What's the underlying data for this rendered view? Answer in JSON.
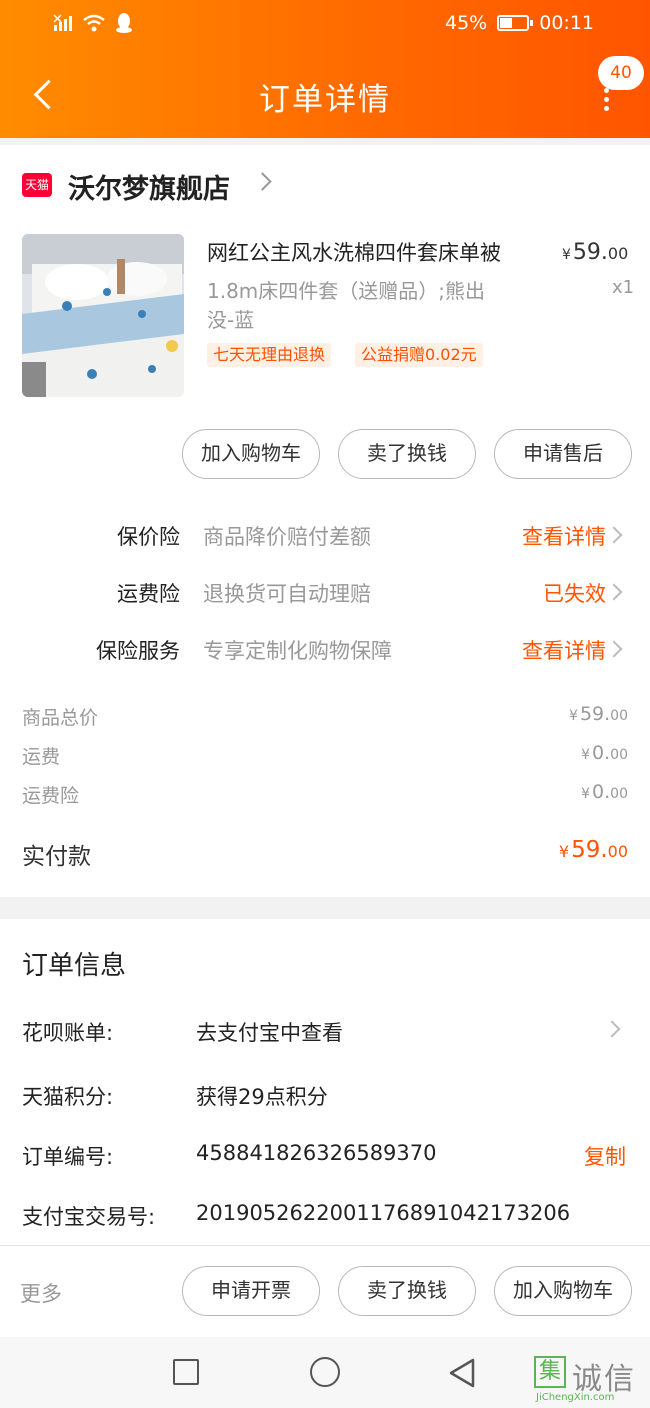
{
  "status_bar": {
    "battery_percent": "45%",
    "time": "00:11",
    "icons": [
      "no-sim-icon",
      "wifi-icon",
      "qq-icon",
      "battery-icon"
    ]
  },
  "header": {
    "title": "订单详情",
    "badge_count": "40",
    "back_icon": "chevron-left-icon",
    "more_icon": "more-vertical-icon"
  },
  "shop": {
    "logo_text": "天猫",
    "name": "沃尔梦旗舰店"
  },
  "product": {
    "title": "网红公主风水洗棉四件套床单被",
    "price_currency": "¥",
    "price_int": "59.",
    "price_dec": "00",
    "sku_line1": "1.8m床四件套（送赠品）;熊出",
    "sku_line2": "没-蓝",
    "quantity": "x1",
    "tags": [
      "七天无理由退换",
      "公益捐赠0.02元"
    ]
  },
  "product_actions": [
    "加入购物车",
    "卖了换钱",
    "申请售后"
  ],
  "insurance": [
    {
      "label": "保价险",
      "desc": "商品降价赔付差额",
      "link": "查看详情"
    },
    {
      "label": "运费险",
      "desc": "退换货可自动理赔",
      "link": "已失效"
    },
    {
      "label": "保险服务",
      "desc": "专享定制化购物保障",
      "link": "查看详情"
    }
  ],
  "summary": [
    {
      "label": "商品总价",
      "currency": "¥",
      "int": "59.",
      "dec": "00"
    },
    {
      "label": "运费",
      "currency": "¥",
      "int": "0.",
      "dec": "00"
    },
    {
      "label": "运费险",
      "currency": "¥",
      "int": "0.",
      "dec": "00"
    }
  ],
  "paid": {
    "label": "实付款",
    "currency": "¥",
    "int": "59.",
    "dec": "00"
  },
  "order_info": {
    "title": "订单信息",
    "rows": [
      {
        "label": "花呗账单:",
        "value": "去支付宝中查看"
      },
      {
        "label": "天猫积分:",
        "value": "获得29点积分"
      },
      {
        "label": "订单编号:",
        "value": "458841826326589370",
        "action": "复制"
      },
      {
        "label": "支付宝交易号:",
        "value": "2019052622001176891042173206"
      }
    ]
  },
  "bottom_bar": {
    "more": "更多",
    "buttons": [
      "申请开票",
      "卖了换钱",
      "加入购物车"
    ]
  },
  "watermark": {
    "box_char": "集",
    "text": "诚信",
    "url": "JiChengXin.com"
  },
  "colors": {
    "accent": "#ff5500",
    "header_start": "#ff8c00",
    "header_end": "#ff5500",
    "tag_bg": "#fff0e6"
  }
}
